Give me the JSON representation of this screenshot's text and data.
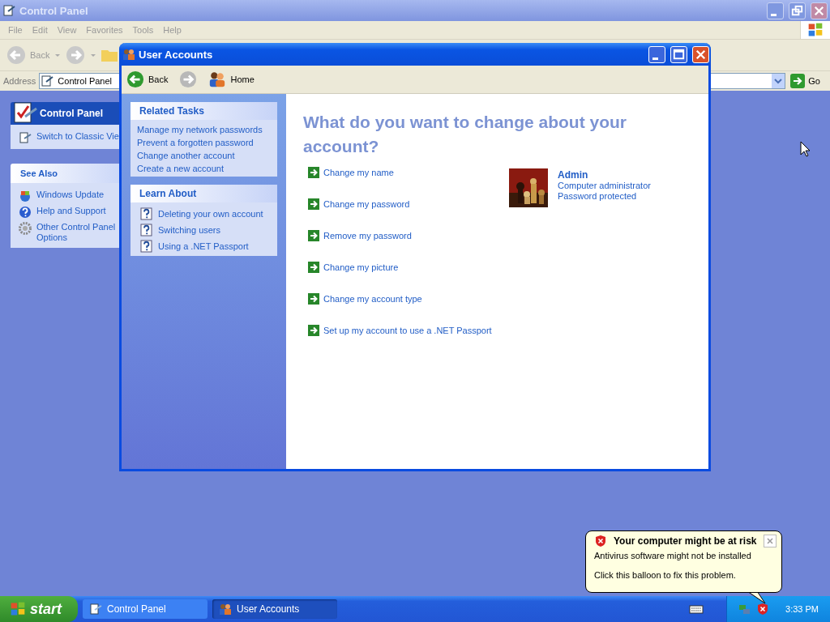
{
  "background_window": {
    "title": "Control Panel",
    "menu": [
      "File",
      "Edit",
      "View",
      "Favorites",
      "Tools",
      "Help"
    ],
    "back": "Back",
    "address_label": "Address",
    "address": "Control Panel",
    "go": "Go",
    "panels": [
      {
        "kind": "header",
        "title": "Control Panel",
        "items": [
          {
            "kind": "classic",
            "label": "Switch to Classic Vie"
          }
        ]
      },
      {
        "kind": "normal",
        "title": "See Also",
        "items": [
          {
            "kind": "update",
            "label": "Windows Update"
          },
          {
            "kind": "help",
            "label": "Help and Support"
          },
          {
            "kind": "gear",
            "label": "Other Control Panel Options"
          }
        ]
      }
    ]
  },
  "dialog": {
    "title": "User Accounts",
    "back": "Back",
    "home": "Home",
    "task_panels": [
      {
        "title": "Related Tasks",
        "items": [
          {
            "kind": "link",
            "label": "Manage my network passwords"
          },
          {
            "kind": "link",
            "label": "Prevent a forgotten password"
          },
          {
            "kind": "link",
            "label": "Change another account"
          },
          {
            "kind": "link",
            "label": "Create a new account"
          }
        ]
      },
      {
        "title": "Learn About",
        "items": [
          {
            "kind": "help",
            "label": "Deleting your own account"
          },
          {
            "kind": "help",
            "label": "Switching users"
          },
          {
            "kind": "help",
            "label": "Using a .NET Passport"
          }
        ]
      }
    ],
    "heading": "What do you want to change about your account?",
    "actions": [
      "Change my name",
      "Change my password",
      "Remove my password",
      "Change my picture",
      "Change my account type",
      "Set up my account to use a .NET Passport"
    ],
    "account": {
      "name": "Admin",
      "type": "Computer administrator",
      "status": "Password protected"
    }
  },
  "balloon": {
    "title": "Your computer might be at risk",
    "line_1": "Antivirus software might not be installed",
    "line_2": "Click this balloon to fix this problem."
  },
  "taskbar": {
    "start": "start",
    "tasks": [
      {
        "label": "Control Panel",
        "kind": "cp",
        "selected": false
      },
      {
        "label": "User Accounts",
        "kind": "users",
        "selected": true
      }
    ],
    "clock": "3:33 PM"
  }
}
